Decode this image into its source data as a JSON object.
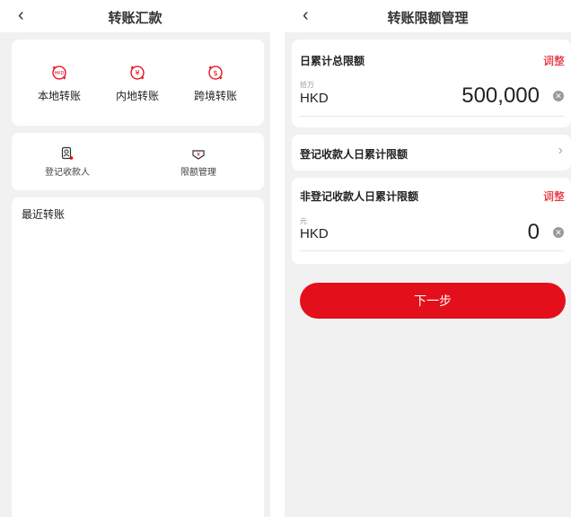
{
  "left": {
    "nav": {
      "back_icon": "‹",
      "title": "转账汇款"
    },
    "services": [
      {
        "label": "本地转账",
        "icon": "hkd-transfer-icon",
        "glyph": "HKD"
      },
      {
        "label": "内地转账",
        "icon": "rmb-transfer-icon",
        "glyph": "¥"
      },
      {
        "label": "跨境转账",
        "icon": "cross-border-transfer-icon",
        "glyph": "$"
      }
    ],
    "tools": [
      {
        "label": "登记收款人",
        "icon": "payee-register-icon"
      },
      {
        "label": "限额管理",
        "icon": "limit-management-icon"
      }
    ],
    "recent": {
      "title": "最近转账"
    }
  },
  "right": {
    "nav": {
      "back_icon": "‹",
      "title": "转账限额管理"
    },
    "daily_total": {
      "title": "日累计总限额",
      "adjust": "调整",
      "unit": "拾万",
      "currency": "HKD",
      "amount": "500,000"
    },
    "registered_payee": {
      "title": "登记收款人日累计限额",
      "chevron": "›"
    },
    "unregistered_payee": {
      "title": "非登记收款人日累计限额",
      "adjust": "调整",
      "unit": "元",
      "currency": "HKD",
      "amount": "0"
    },
    "next_button": "下一步"
  },
  "colors": {
    "accent": "#e60012",
    "background": "#f1f1f1"
  }
}
